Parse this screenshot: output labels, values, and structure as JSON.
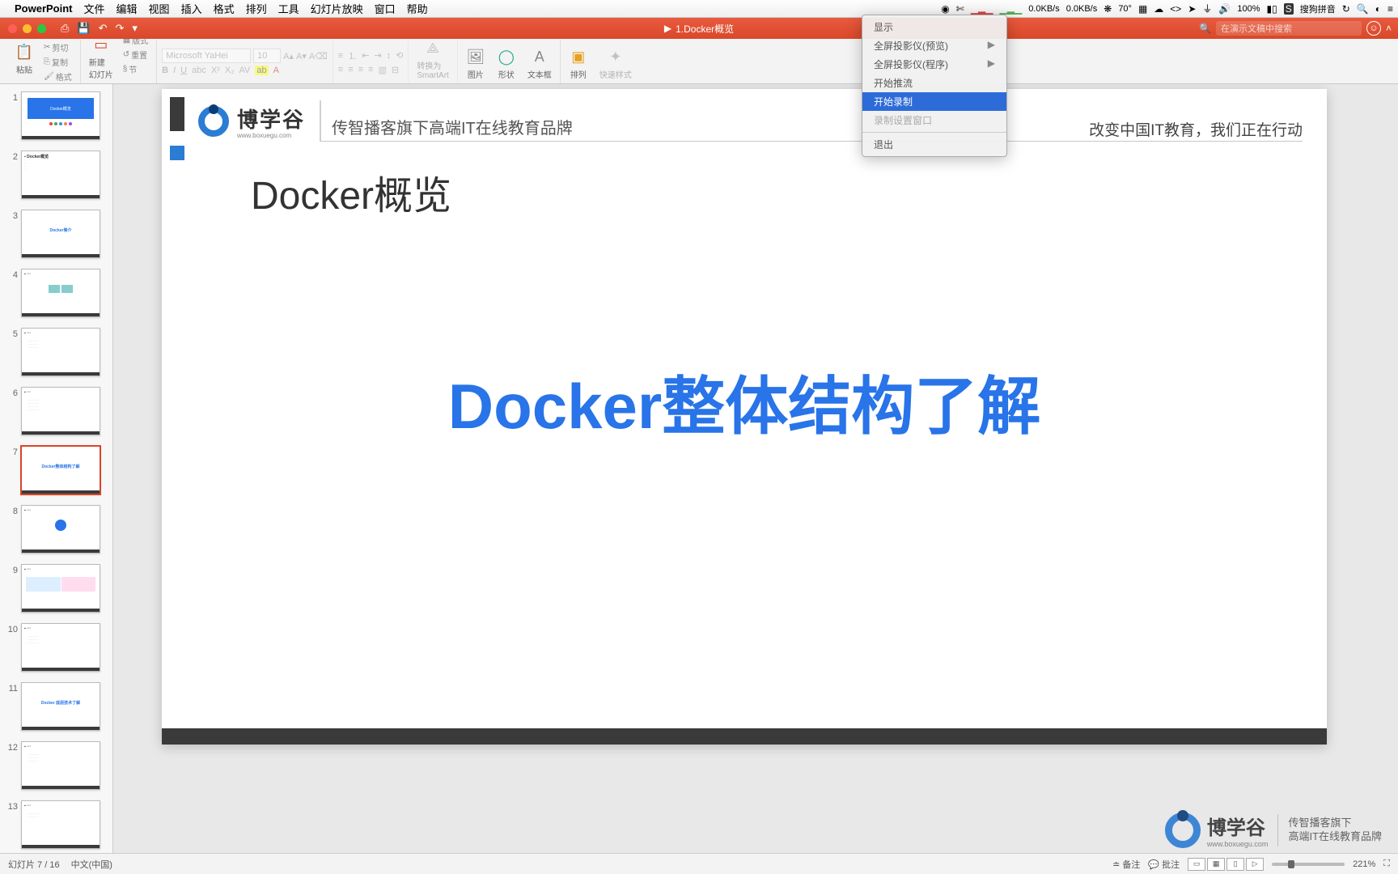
{
  "menubar": {
    "app": "PowerPoint",
    "items": [
      "文件",
      "编辑",
      "视图",
      "插入",
      "格式",
      "排列",
      "工具",
      "幻灯片放映",
      "窗口",
      "帮助"
    ],
    "right": {
      "net_up": "0.0KB/s",
      "net_down": "0.0KB/s",
      "temp": "70°",
      "battery": "100%",
      "ime": "搜狗拼音"
    }
  },
  "titlebar": {
    "doc": "1.Docker概览",
    "search_placeholder": "在演示文稿中搜索"
  },
  "ribbon": {
    "paste": "粘贴",
    "cut": "剪切",
    "copy": "复制",
    "format": "格式",
    "newslide": "新建\n幻灯片",
    "layout": "版式",
    "reset": "重置",
    "section": "节",
    "font_name": "Microsoft YaHei",
    "font_size": "10",
    "smartart": "转换为\nSmartArt",
    "picture": "图片",
    "shapes": "形状",
    "textbox": "文本框",
    "arrange": "排列",
    "quickstyle": "快速样式"
  },
  "dropdown": {
    "items": [
      {
        "label": "显示",
        "arrow": false
      },
      {
        "label": "全屏投影仪(预览)",
        "arrow": true
      },
      {
        "label": "全屏投影仪(程序)",
        "arrow": true
      },
      {
        "label": "开始推流",
        "arrow": false
      },
      {
        "label": "开始录制",
        "arrow": false,
        "hi": true
      },
      {
        "label": "录制设置窗口",
        "arrow": false
      },
      {
        "label": "退出",
        "arrow": false
      }
    ]
  },
  "slide": {
    "logo_text": "博学谷",
    "logo_sub": "www.boxuegu.com",
    "brand_tag": "传智播客旗下高端IT在线教育品牌",
    "right_tag": "改变中国IT教育，我们正在行动",
    "overview": "Docker概览",
    "big_title": "Docker整体结构了解"
  },
  "thumbs": {
    "count": 13,
    "selected": 7
  },
  "status": {
    "slide_info": "幻灯片 7 / 16",
    "lang": "中文(中国)",
    "notes": "备注",
    "comments": "批注",
    "zoom": "221%"
  },
  "watermark": {
    "name": "博学谷",
    "sub": "www.boxuegu.com",
    "desc1": "传智播客旗下",
    "desc2": "高端IT在线教育品牌"
  }
}
